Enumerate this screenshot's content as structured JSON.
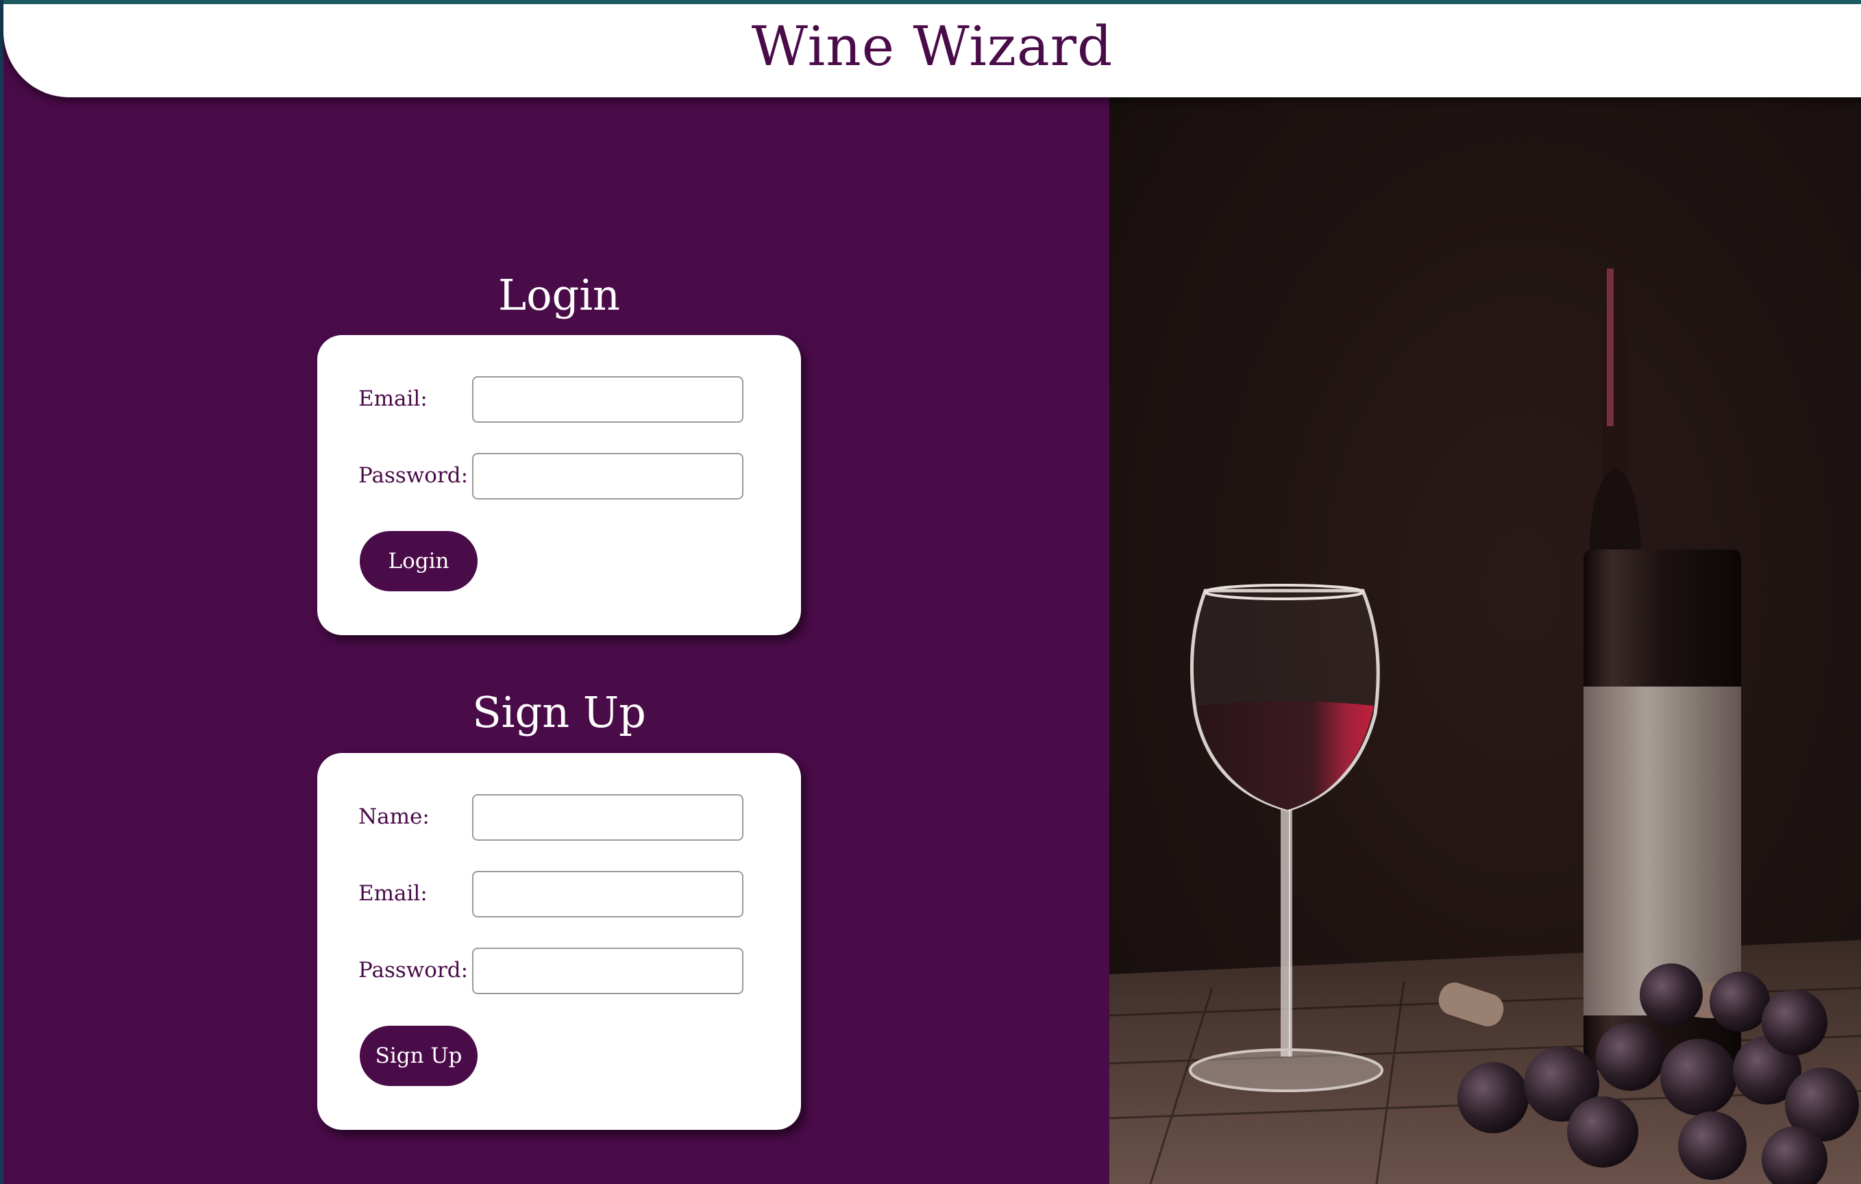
{
  "header": {
    "title": "Wine Wizard"
  },
  "login": {
    "title": "Login",
    "email_label": "Email:",
    "email_value": "",
    "password_label": "Password:",
    "password_value": "",
    "button_label": "Login"
  },
  "signup": {
    "title": "Sign Up",
    "name_label": "Name:",
    "name_value": "",
    "email_label": "Email:",
    "email_value": "",
    "password_label": "Password:",
    "password_value": "",
    "button_label": "Sign Up"
  },
  "colors": {
    "brand": "#4a0b49",
    "header_bg": "#ffffff",
    "top_strip": "#1d5c63"
  },
  "image": {
    "subject": "red-wine-glass-bottle-grapes"
  }
}
